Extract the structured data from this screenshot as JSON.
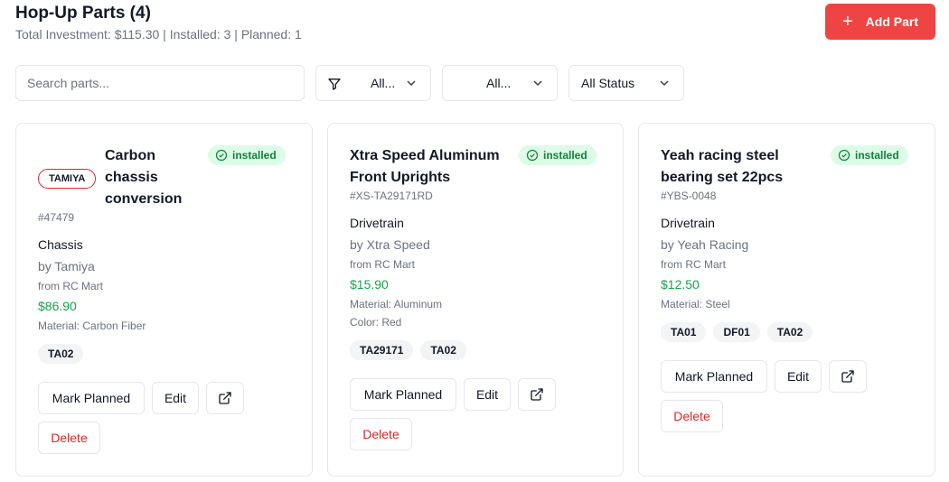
{
  "header": {
    "title": "Hop-Up Parts (4)",
    "summary": "Total Investment: $115.30 | Installed: 3 | Planned: 1",
    "add_button_label": "Add Part"
  },
  "filters": {
    "search_placeholder": "Search parts...",
    "category_value": "All...",
    "brand_value": "All...",
    "status_value": "All Status"
  },
  "colors": {
    "accent": "#ef4444",
    "installed_bg": "#dcfce7",
    "installed_text": "#15803d",
    "price": "#16a34a",
    "delete": "#dc2626"
  },
  "cards": [
    {
      "brand_badge": "TAMIYA",
      "name_lines": [
        "Carbon",
        "chassis",
        "conversion"
      ],
      "status": "installed",
      "sku": "#47479",
      "category": "Chassis",
      "maker": "by Tamiya",
      "vendor": "from RC Mart",
      "price": "$86.90",
      "material": "Material: Carbon Fiber",
      "tags": [
        "TA02"
      ],
      "mark_planned_label": "Mark Planned",
      "edit_label": "Edit",
      "delete_label": "Delete"
    },
    {
      "name_lines": [
        "Xtra Speed Aluminum",
        "Front Uprights"
      ],
      "status": "installed",
      "sku": "#XS-TA29171RD",
      "category": "Drivetrain",
      "maker": "by Xtra Speed",
      "vendor": "from RC Mart",
      "price": "$15.90",
      "material": "Material: Aluminum",
      "color": "Color: Red",
      "tags": [
        "TA29171",
        "TA02"
      ],
      "mark_planned_label": "Mark Planned",
      "edit_label": "Edit",
      "delete_label": "Delete"
    },
    {
      "name_lines": [
        "Yeah racing steel",
        "bearing set 22pcs"
      ],
      "status": "installed",
      "sku": "#YBS-0048",
      "category": "Drivetrain",
      "maker": "by Yeah Racing",
      "vendor": "from RC Mart",
      "price": "$12.50",
      "material": "Material: Steel",
      "tags": [
        "TA01",
        "DF01",
        "TA02"
      ],
      "mark_planned_label": "Mark Planned",
      "edit_label": "Edit",
      "delete_label": "Delete"
    }
  ]
}
